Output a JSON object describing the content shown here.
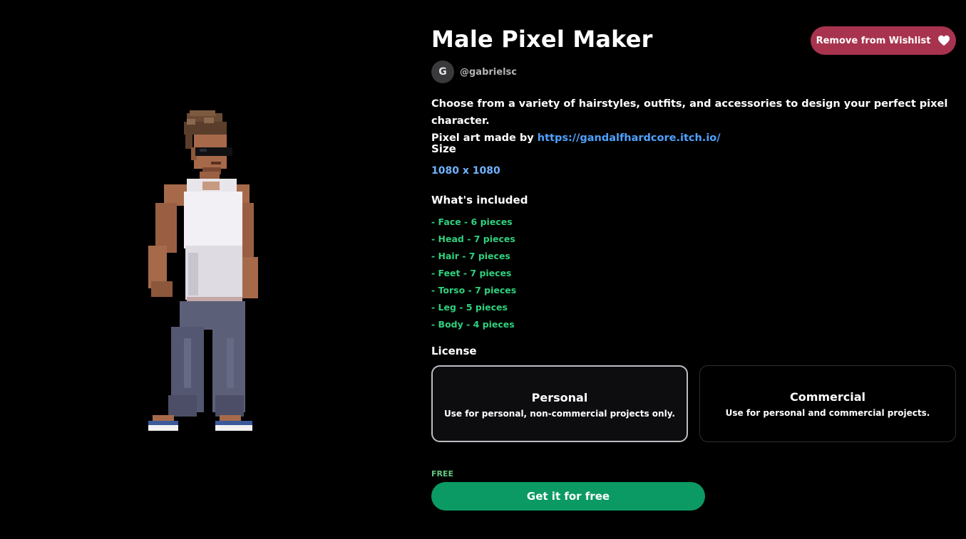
{
  "product": {
    "title": "Male Pixel Maker",
    "author_initial": "G",
    "author_handle": "@gabrielsc",
    "description_line1": "Choose from a variety of hairstyles, outfits, and accessories to design your perfect pixel character.",
    "description_prefix": "Pixel art made by",
    "description_link": "https://gandalfhardcore.itch.io/"
  },
  "wishlist": {
    "label": "Remove from Wishlist",
    "icon": "heart-icon"
  },
  "size": {
    "title": "Size",
    "value": "1080 x 1080"
  },
  "included": {
    "title": "What's included",
    "items": [
      "- Face - 6 pieces",
      "- Head - 7 pieces",
      "- Hair - 7 pieces",
      "- Feet - 7 pieces",
      "- Torso - 7 pieces",
      "- Leg - 5 pieces",
      "- Body - 4 pieces"
    ]
  },
  "license": {
    "title": "License",
    "options": [
      {
        "name": "Personal",
        "description": "Use for personal, non-commercial projects only.",
        "selected": true
      },
      {
        "name": "Commercial",
        "description": "Use for personal and commercial projects.",
        "selected": false
      }
    ]
  },
  "price": {
    "label": "FREE",
    "button": "Get it for free"
  },
  "colors": {
    "background": "#000000",
    "wishlist": "#a8334f",
    "primary_button": "#0b9a63",
    "link": "#4ea1ff",
    "included_text": "#2fd17e"
  }
}
